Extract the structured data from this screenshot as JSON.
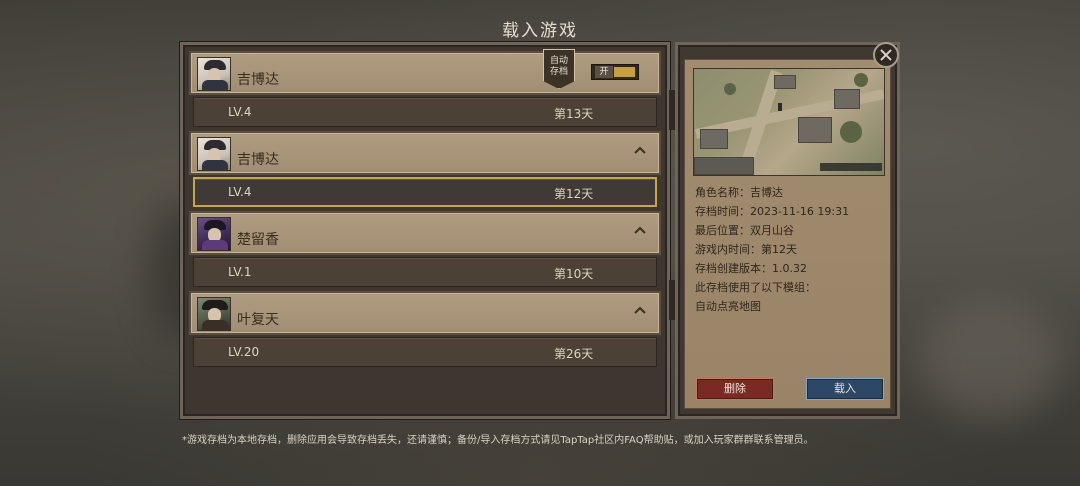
{
  "screen": {
    "title": "载入游戏"
  },
  "autosave": {
    "badge_label": "自动存档",
    "toggle_label": "开"
  },
  "saves": [
    {
      "name": "吉博达",
      "level": "LV.4",
      "day": "第13天",
      "avatar": "gibda-portrait"
    },
    {
      "name": "吉博达",
      "level": "LV.4",
      "day": "第12天",
      "avatar": "gibda-portrait"
    },
    {
      "name": "楚留香",
      "level": "LV.1",
      "day": "第10天",
      "avatar": "chu-liuxiang-portrait"
    },
    {
      "name": "叶复天",
      "level": "LV.20",
      "day": "第26天",
      "avatar": "ye-futian-portrait"
    }
  ],
  "details": {
    "character": "角色名称：吉博达",
    "save_time": "存档时间：2023-11-16 19:31",
    "last_location": "最后位置：双月山谷",
    "ingame_time": "游戏内时间：第12天",
    "version": "存档创建版本：1.0.32",
    "mods_header": "此存档使用了以下模组：",
    "mods": [
      "自动点亮地图"
    ]
  },
  "buttons": {
    "delete": "删除",
    "load": "载入"
  },
  "footnote": "*游戏存档为本地存档，删除应用会导致存档丢失，还请谨慎；备份/导入存档方式请见TapTap社区内FAQ帮助贴，或加入玩家群群联系管理员。",
  "icons": {
    "close": "close-icon",
    "collapse": "chevron-up-icon"
  },
  "colors": {
    "selected_border": "#c9a646",
    "delete_button": "#7a2a24",
    "load_button": "#2d4766"
  }
}
